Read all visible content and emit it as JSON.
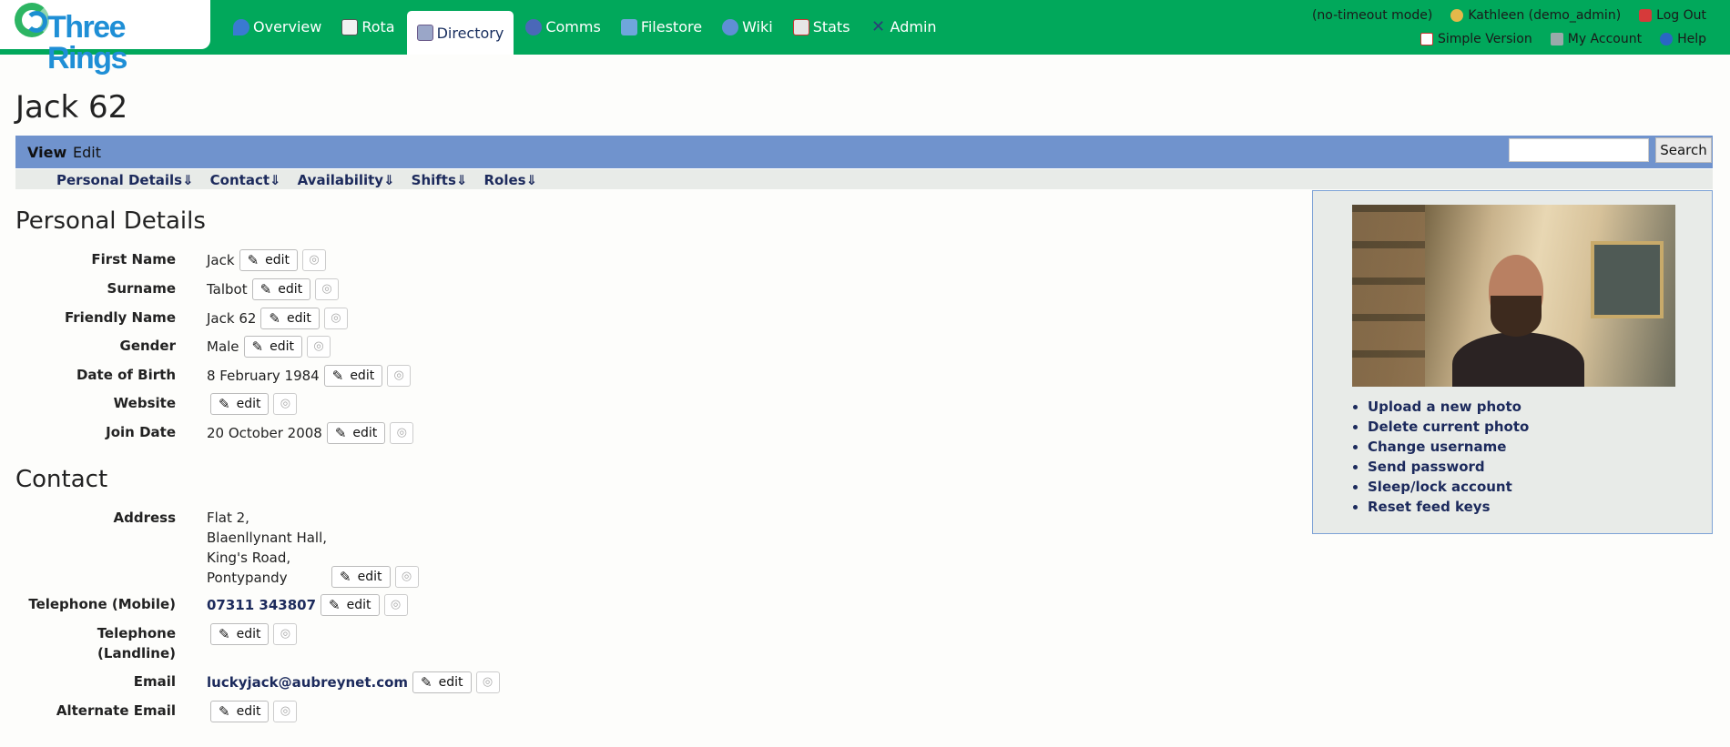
{
  "logo": {
    "text": "Three Rings"
  },
  "nav": [
    {
      "label": "Overview",
      "icon": "overview-icon",
      "color": "#3a7ad1"
    },
    {
      "label": "Rota",
      "icon": "calendar-icon",
      "color": "#f2f2f2"
    },
    {
      "label": "Directory",
      "icon": "book-icon",
      "color": "#9aa6c8",
      "active": true
    },
    {
      "label": "Comms",
      "icon": "envelope-icon",
      "color": "#4a68b8"
    },
    {
      "label": "Filestore",
      "icon": "folder-icon",
      "color": "#6fa6dc"
    },
    {
      "label": "Wiki",
      "icon": "globe-icon",
      "color": "#5f8fd6"
    },
    {
      "label": "Stats",
      "icon": "chart-icon",
      "color": "#e6e6e6"
    },
    {
      "label": "Admin",
      "icon": "tools-icon",
      "color": "#5a7ab0"
    }
  ],
  "topright": {
    "mode": "(no-timeout mode)",
    "user": "Kathleen (demo_admin)",
    "logout": "Log Out",
    "simple": "Simple Version",
    "account": "My Account",
    "help": "Help"
  },
  "page": {
    "title": "Jack 62"
  },
  "viewbar": {
    "view": "View",
    "edit": "Edit",
    "search_button": "Search",
    "search_value": ""
  },
  "anchors": [
    "Personal Details⇓",
    "Contact⇓",
    "Availability⇓",
    "Shifts⇓",
    "Roles⇓"
  ],
  "edit_label": "edit",
  "personal": {
    "heading": "Personal Details",
    "rows": [
      {
        "label": "First Name",
        "value": "Jack"
      },
      {
        "label": "Surname",
        "value": "Talbot"
      },
      {
        "label": "Friendly Name",
        "value": "Jack 62"
      },
      {
        "label": "Gender",
        "value": "Male"
      },
      {
        "label": "Date of Birth",
        "value": "8 February 1984"
      },
      {
        "label": "Website",
        "value": ""
      },
      {
        "label": "Join Date",
        "value": "20 October 2008"
      }
    ]
  },
  "contact": {
    "heading": "Contact",
    "address_label": "Address",
    "address_lines": [
      "Flat 2,",
      "Blaenllynant Hall,",
      "King's Road,",
      "Pontypandy"
    ],
    "mobile_label": "Telephone (Mobile)",
    "mobile": "07311 343807",
    "landline_label_1": "Telephone",
    "landline_label_2": "(Landline)",
    "email_label": "Email",
    "email": "luckyjack@aubreynet.com",
    "alt_email_label": "Alternate Email"
  },
  "photo_actions": [
    "Upload a new photo",
    "Delete current photo",
    "Change username",
    "Send password",
    "Sleep/lock account",
    "Reset feed keys"
  ]
}
